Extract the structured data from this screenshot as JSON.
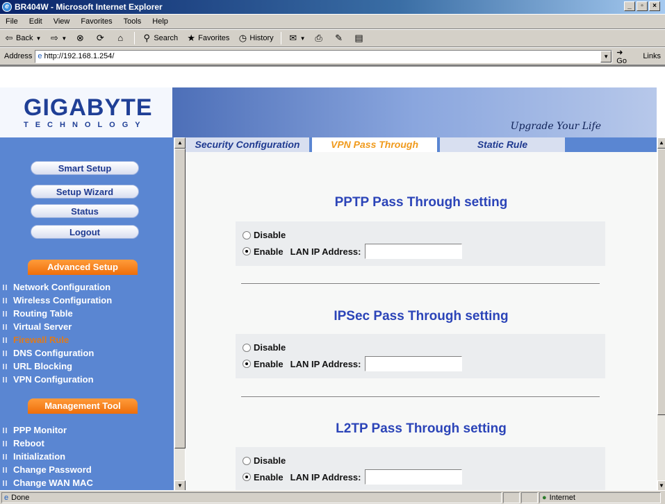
{
  "window": {
    "title": "BR404W - Microsoft Internet Explorer"
  },
  "menu": [
    "File",
    "Edit",
    "View",
    "Favorites",
    "Tools",
    "Help"
  ],
  "toolbar": {
    "back": "Back",
    "search": "Search",
    "favorites": "Favorites",
    "history": "History"
  },
  "address": {
    "label": "Address",
    "url": "http://192.168.1.254/",
    "go": "Go",
    "links": "Links"
  },
  "brand": {
    "logo_main": "GIGABYTE",
    "logo_sub": "TECHNOLOGY",
    "slogan": "Upgrade Your Life"
  },
  "sidebar": {
    "buttons": [
      "Smart Setup",
      "Setup Wizard",
      "Status",
      "Logout"
    ],
    "advanced_title": "Advanced Setup",
    "advanced_items": [
      "Network Configuration",
      "Wireless Configuration",
      "Routing Table",
      "Virtual Server",
      "Firewall Rule",
      "DNS Configuration",
      "URL Blocking",
      "VPN Configuration"
    ],
    "management_title": "Management Tool",
    "management_items": [
      "PPP Monitor",
      "Reboot",
      "Initialization",
      "Change Password",
      "Change WAN MAC"
    ]
  },
  "tabs": [
    "Security Configuration",
    "VPN Pass Through",
    "Static Rule"
  ],
  "sections": [
    {
      "title": "PPTP Pass Through setting",
      "disable": "Disable",
      "enable": "Enable",
      "ip_label": "LAN IP Address:",
      "ip_value": ""
    },
    {
      "title": "IPSec Pass Through setting",
      "disable": "Disable",
      "enable": "Enable",
      "ip_label": "LAN IP Address:",
      "ip_value": ""
    },
    {
      "title": "L2TP Pass Through setting",
      "disable": "Disable",
      "enable": "Enable",
      "ip_label": "LAN IP Address:",
      "ip_value": ""
    }
  ],
  "status": {
    "text": "Done",
    "zone": "Internet"
  }
}
